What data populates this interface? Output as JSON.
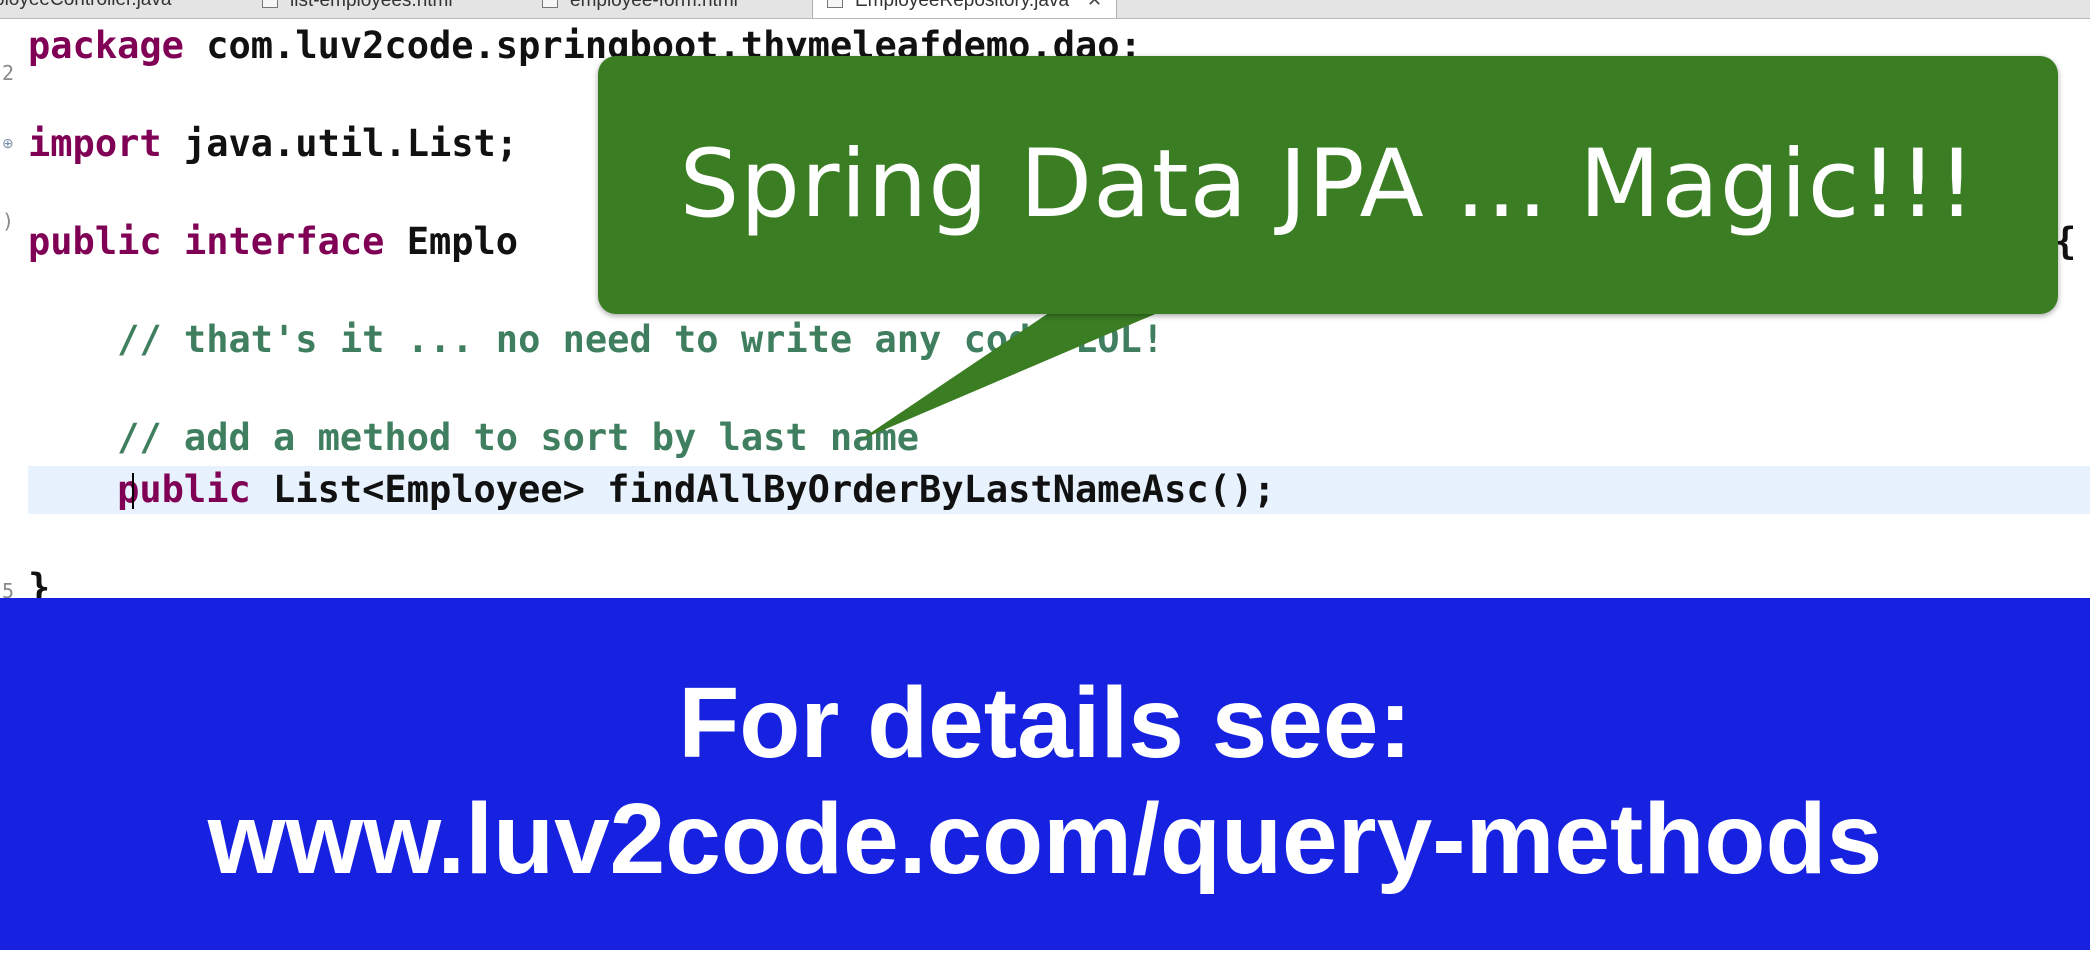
{
  "tabs": [
    {
      "label": "ployeeController.java"
    },
    {
      "label": "list-employees.html"
    },
    {
      "label": "employee-form.html"
    },
    {
      "label": "EmployeeRepository.java",
      "active": true
    }
  ],
  "code": {
    "line1": {
      "keyword": "package",
      "rest": " com.luv2code.springboot.thymeleafdemo.dao;"
    },
    "line2": {
      "keyword": "import",
      "rest": " java.util.List;"
    },
    "line3": {
      "keyword1": "public",
      "keyword2": "interface",
      "rest": " Emplo",
      "tail": "{"
    },
    "line4": {
      "comment": "    // that's it ... no need to write any code LOL!"
    },
    "line5": {
      "comment": "    // add a method to sort by last name"
    },
    "line6": {
      "indent": "    ",
      "keyword": "public",
      "rest": " List<Employee> findAllByOrderByLastNameAsc();"
    },
    "line7": {
      "text": "}"
    }
  },
  "callout": {
    "text": "Spring Data JPA ... Magic!!!",
    "color": "#3a7d23"
  },
  "banner": {
    "line1": "For details see:",
    "line2": "www.luv2code.com/query-methods",
    "color": "#1722e0"
  },
  "colors": {
    "keyword": "#7f0055",
    "comment": "#3f7f5f",
    "current_line": "#e8f2fe"
  }
}
